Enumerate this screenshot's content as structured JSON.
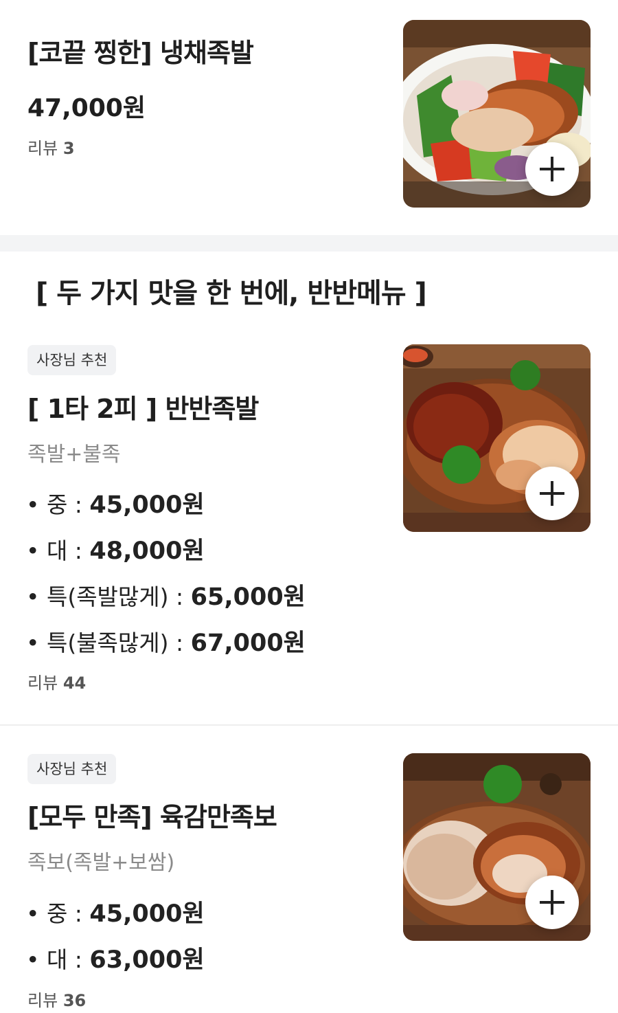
{
  "items": [
    {
      "title": "[코끝 찡한] 냉채족발",
      "price": "47,000원",
      "review_label": "리뷰",
      "review_count": "3",
      "image_alt": "냉채족발 food photo"
    },
    {
      "badge": "사장님 추천",
      "title": "[ 1타 2피 ] 반반족발",
      "description": "족발+불족",
      "options": [
        {
          "label": "• 중 : ",
          "price": "45,000원"
        },
        {
          "label": "• 대 : ",
          "price": "48,000원"
        },
        {
          "label": "• 특(족발많게) : ",
          "price": "65,000원"
        },
        {
          "label": "• 특(불족많게) : ",
          "price": "67,000원"
        }
      ],
      "review_label": "리뷰",
      "review_count": "44",
      "image_alt": "반반족발 food photo"
    },
    {
      "badge": "사장님 추천",
      "title": "[모두 만족] 육감만족보",
      "description": "족보(족발+보쌈)",
      "options": [
        {
          "label": "• 중 : ",
          "price": "45,000원"
        },
        {
          "label": "• 대 : ",
          "price": "63,000원"
        }
      ],
      "review_label": "리뷰",
      "review_count": "36",
      "image_alt": "육감만족보 food photo"
    }
  ],
  "section_title": "[ 두 가지 맛을 한 번에, 반반메뉴 ]",
  "icons": {
    "add": "plus-icon"
  },
  "colors": {
    "background": "#ffffff",
    "divider": "#f3f4f5",
    "badge_bg": "#f1f2f4",
    "muted_text": "#8a8a8a"
  }
}
